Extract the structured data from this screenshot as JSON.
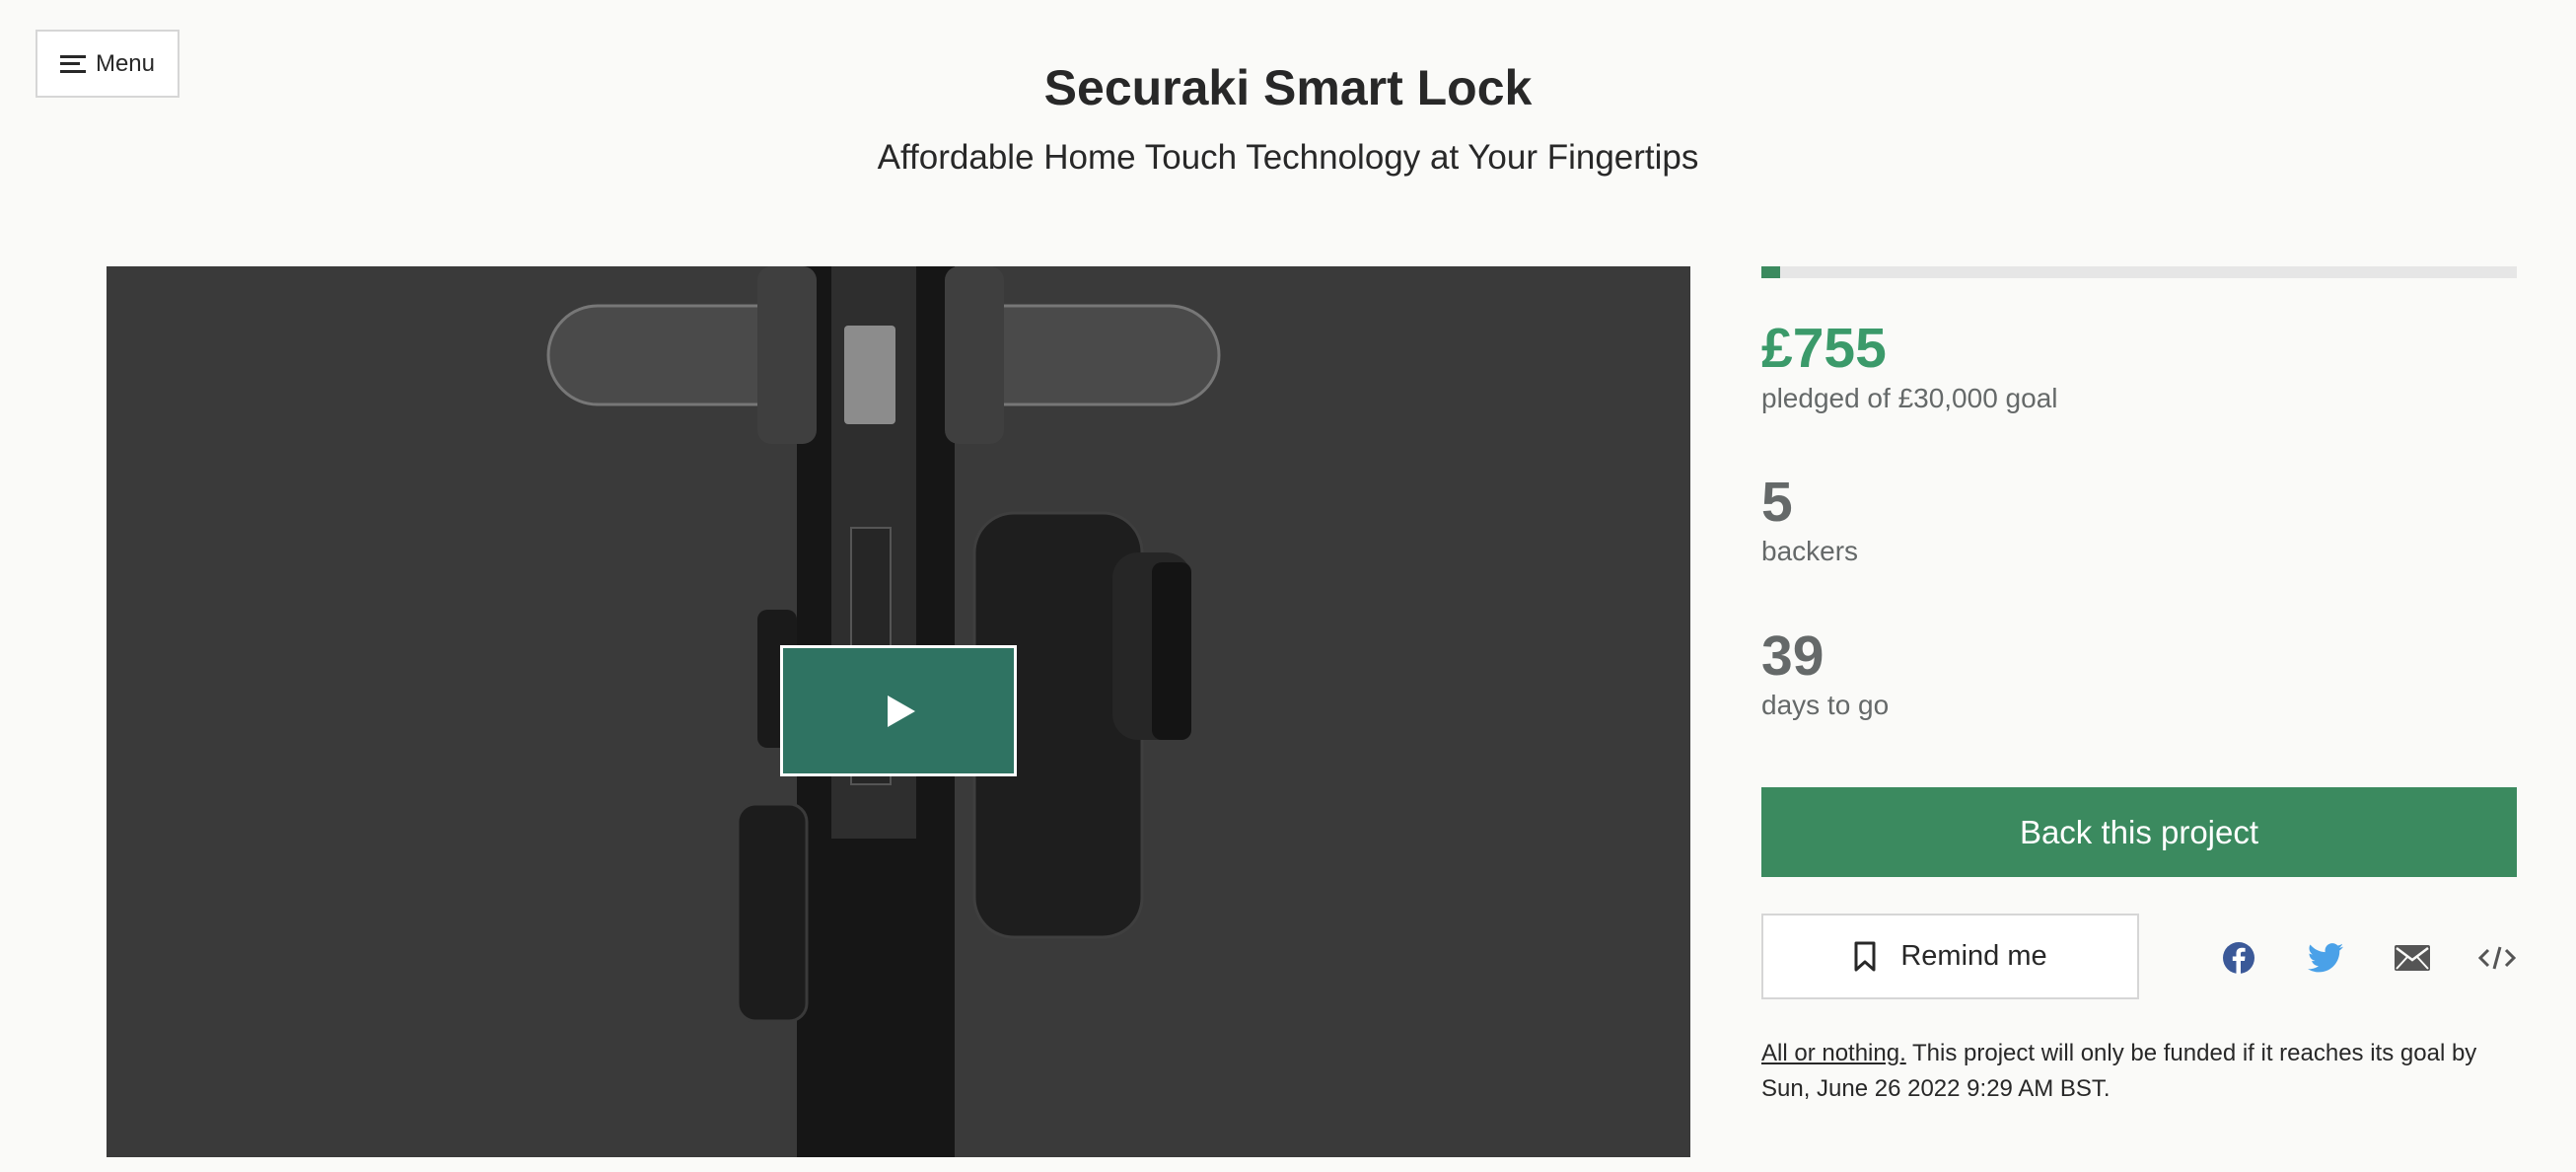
{
  "header": {
    "menu_label": "Menu"
  },
  "project": {
    "title": "Securaki Smart Lock",
    "subtitle": "Affordable Home Touch Technology at Your Fingertips"
  },
  "stats": {
    "pledged": "£755",
    "pledged_label": "pledged of £30,000 goal",
    "funding_progress_fraction": 0.025,
    "backers": "5",
    "backers_label": "backers",
    "days": "39",
    "days_label": "days to go"
  },
  "actions": {
    "back_label": "Back this project",
    "remind_label": "Remind me"
  },
  "share_icons": [
    "facebook-icon",
    "twitter-icon",
    "email-icon",
    "embed-icon"
  ],
  "colors": {
    "accent_green": "#3b8a5f",
    "pledged_green": "#3b9a6a",
    "play_button": "#2f7362"
  },
  "funding_note": {
    "all_or_nothing": "All or nothing.",
    "text": " This project will only be funded if it reaches its goal by Sun, June 26 2022 9:29 AM BST."
  }
}
